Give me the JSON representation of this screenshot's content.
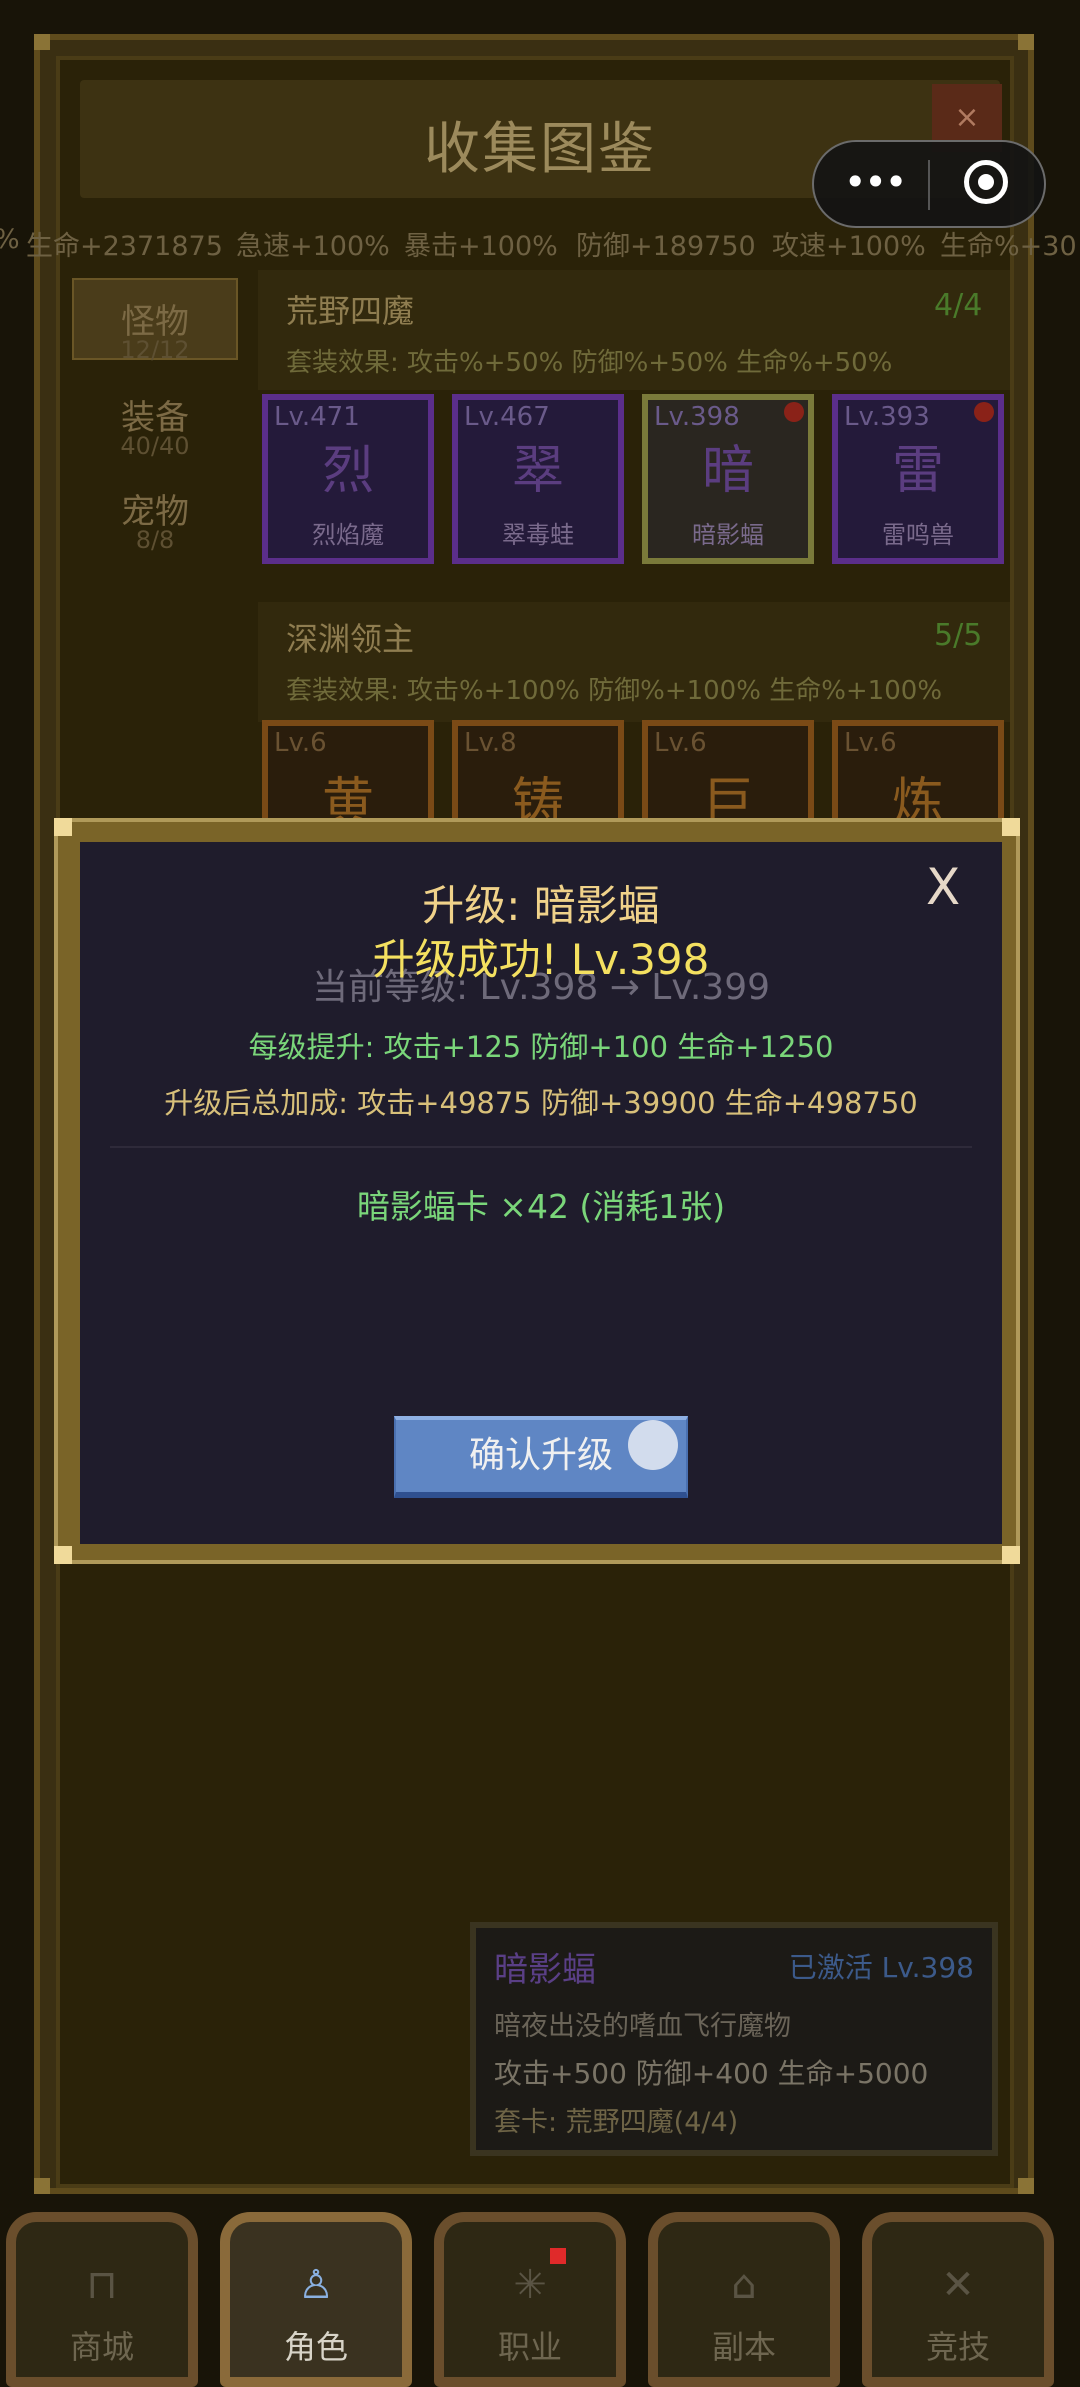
{
  "window": {
    "title": "收集图鉴",
    "close_label": "×"
  },
  "stats_strip": [
    "%",
    "生命+2371875",
    "急速+100%",
    "暴击+100%",
    "防御+189750",
    "攻速+100%",
    "生命%+30"
  ],
  "tabs": [
    {
      "label": "怪物",
      "count": "12/12"
    },
    {
      "label": "装备",
      "count": "40/40"
    },
    {
      "label": "宠物",
      "count": "8/8"
    }
  ],
  "groups": [
    {
      "name": "荒野四魔",
      "count": "4/4",
      "effect": "套装效果: 攻击%+50% 防御%+50% 生命%+50%",
      "cards": [
        {
          "level": "Lv.471",
          "glyph": "烈",
          "name": "烈焰魔",
          "badge": false
        },
        {
          "level": "Lv.467",
          "glyph": "翠",
          "name": "翠毒蛙",
          "badge": false
        },
        {
          "level": "Lv.398",
          "glyph": "暗",
          "name": "暗影蝠",
          "badge": true
        },
        {
          "level": "Lv.393",
          "glyph": "雷",
          "name": "雷鸣兽",
          "badge": true
        }
      ]
    },
    {
      "name": "深渊领主",
      "count": "5/5",
      "effect": "套装效果: 攻击%+100% 防御%+100% 生命%+100%",
      "cards": [
        {
          "level": "Lv.6",
          "glyph": "黄"
        },
        {
          "level": "Lv.8",
          "glyph": "铸"
        },
        {
          "level": "Lv.6",
          "glyph": "巨"
        },
        {
          "level": "Lv.6",
          "glyph": "炼"
        }
      ]
    }
  ],
  "info_panel": {
    "name": "暗影蝠",
    "status": "已激活 Lv.398",
    "desc": "暗夜出没的嗜血飞行魔物",
    "stats": "攻击+500  防御+400  生命+5000",
    "set": "套卡: 荒野四魔(4/4)"
  },
  "modal": {
    "title": "升级: 暗影蝠",
    "success_toast": "升级成功! Lv.398",
    "level_change": "当前等级: Lv.398 → Lv.399",
    "per_level": "每级提升: 攻击+125  防御+100  生命+1250",
    "total_after": "升级后总加成: 攻击+49875  防御+39900  生命+498750",
    "cards_owned": "暗影蝠卡 ×42 (消耗1张)",
    "confirm_label": "确认升级",
    "close_label": "X"
  },
  "nav": [
    {
      "label": "商城",
      "icon": "shop-icon",
      "active": false
    },
    {
      "label": "角色",
      "icon": "character-icon",
      "active": true
    },
    {
      "label": "职业",
      "icon": "class-icon",
      "active": false
    },
    {
      "label": "副本",
      "icon": "dungeon-icon",
      "active": false
    },
    {
      "label": "竞技",
      "icon": "arena-icon",
      "active": false
    }
  ],
  "colors": {
    "modal_title": "#f0d28a",
    "toast": "#f4e060",
    "green_text": "#7ad67a",
    "gold_text": "#d8c07a",
    "confirm_button": "#5f86c4"
  }
}
